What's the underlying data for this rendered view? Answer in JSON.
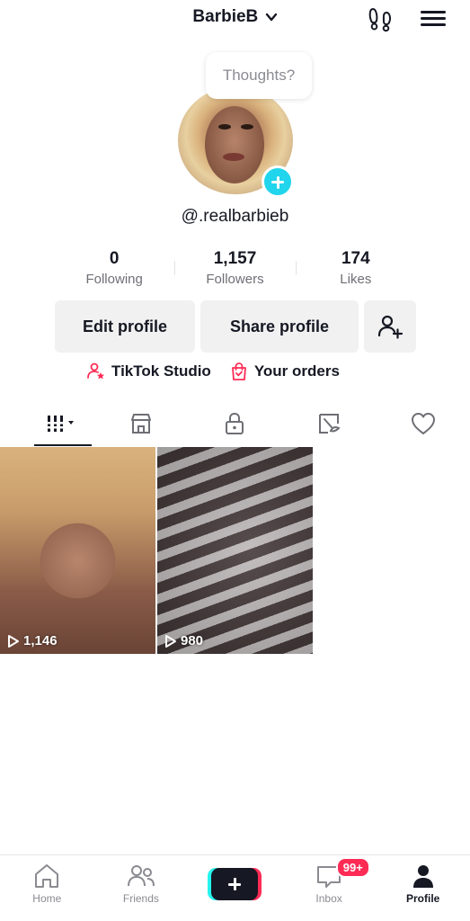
{
  "header": {
    "account_name": "BarbieB"
  },
  "thought_bubble": {
    "placeholder": "Thoughts?"
  },
  "profile": {
    "handle": "@.realbarbieb",
    "stats": [
      {
        "value": "0",
        "label": "Following"
      },
      {
        "value": "1,157",
        "label": "Followers"
      },
      {
        "value": "174",
        "label": "Likes"
      }
    ]
  },
  "actions": {
    "edit_label": "Edit profile",
    "share_label": "Share profile"
  },
  "links": {
    "studio_label": "TikTok Studio",
    "orders_label": "Your orders"
  },
  "tabs": [
    "videos-grid",
    "shop",
    "private",
    "reposts",
    "liked"
  ],
  "videos": [
    {
      "views": "1,146"
    },
    {
      "views": "980"
    }
  ],
  "bottom_nav": {
    "home_label": "Home",
    "friends_label": "Friends",
    "inbox_label": "Inbox",
    "inbox_badge": "99+",
    "profile_label": "Profile"
  },
  "colors": {
    "accent_cyan": "#20d5ec",
    "badge_red": "#fe2c55",
    "text_dark": "#161823"
  }
}
